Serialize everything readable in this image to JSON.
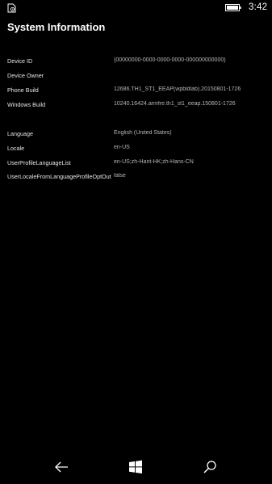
{
  "status_bar": {
    "time": "3:42",
    "left_icon": "notification-icon",
    "battery_icon": "battery-icon"
  },
  "page": {
    "title": "System Information"
  },
  "device_info": [
    {
      "label": "Device ID",
      "value": "{00000000-0000-0000-0000-000000000000}"
    },
    {
      "label": "Device Owner",
      "value": ""
    },
    {
      "label": "Phone Build",
      "value": "12686.TH1_ST1_EEAP(wpbldlab).20150801-1726"
    },
    {
      "label": "Windows Build",
      "value": "10240.16424.armfre.th1_st1_eeap.150801-1726"
    }
  ],
  "locale_info": [
    {
      "label": "Language",
      "value": "English (United States)"
    },
    {
      "label": "Locale",
      "value": "en-US"
    },
    {
      "label": "UserProfileLanguageList",
      "value": "en-US;zh-Hant-HK;zh-Hans-CN"
    },
    {
      "label": "UserLocaleFromLanguageProfileOptOut",
      "value": "false"
    }
  ],
  "nav_bar": {
    "back_icon": "back-arrow-icon",
    "home_icon": "windows-logo-icon",
    "search_icon": "search-icon"
  },
  "colors": {
    "background": "#000000",
    "label": "#e6e6e6",
    "value": "#b5b5b5"
  }
}
